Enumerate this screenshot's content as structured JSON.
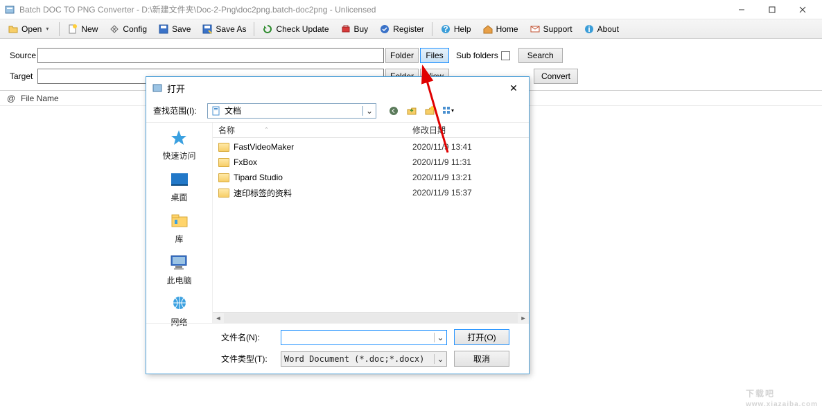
{
  "window": {
    "title": "Batch DOC TO PNG Converter - D:\\新建文件夹\\Doc-2-Png\\doc2png.batch-doc2png - Unlicensed"
  },
  "toolbar": {
    "open": "Open",
    "new": "New",
    "config": "Config",
    "save": "Save",
    "save_as": "Save As",
    "check_update": "Check Update",
    "buy": "Buy",
    "register": "Register",
    "help": "Help",
    "home": "Home",
    "support": "Support",
    "about": "About"
  },
  "form": {
    "source_label": "Source",
    "target_label": "Target",
    "folder_btn": "Folder",
    "files_btn": "Files",
    "view_btn": "View",
    "sub_folders_label": "Sub folders",
    "search_btn": "Search",
    "convert_btn": "Convert"
  },
  "table": {
    "at": "@",
    "file_name": "File Name"
  },
  "dialog": {
    "title": "打开",
    "lookin_label": "查找范围(I):",
    "lookin_value": "文档",
    "places": {
      "quick": "快速访问",
      "desktop": "桌面",
      "libraries": "库",
      "thispc": "此电脑",
      "network": "网络"
    },
    "columns": {
      "name": "名称",
      "date": "修改日期"
    },
    "rows": [
      {
        "name": "FastVideoMaker",
        "date": "2020/11/9 13:41"
      },
      {
        "name": "FxBox",
        "date": "2020/11/9 11:31"
      },
      {
        "name": "Tipard Studio",
        "date": "2020/11/9 13:21"
      },
      {
        "name": "速印标签的资料",
        "date": "2020/11/9 15:37"
      }
    ],
    "filename_label": "文件名(N):",
    "filetype_label": "文件类型(T):",
    "filetype_value": "Word Document (*.doc;*.docx)",
    "open_btn": "打开(O)",
    "cancel_btn": "取消"
  },
  "watermark": {
    "main": "下载吧",
    "sub": "www.xiazaiba.com"
  }
}
